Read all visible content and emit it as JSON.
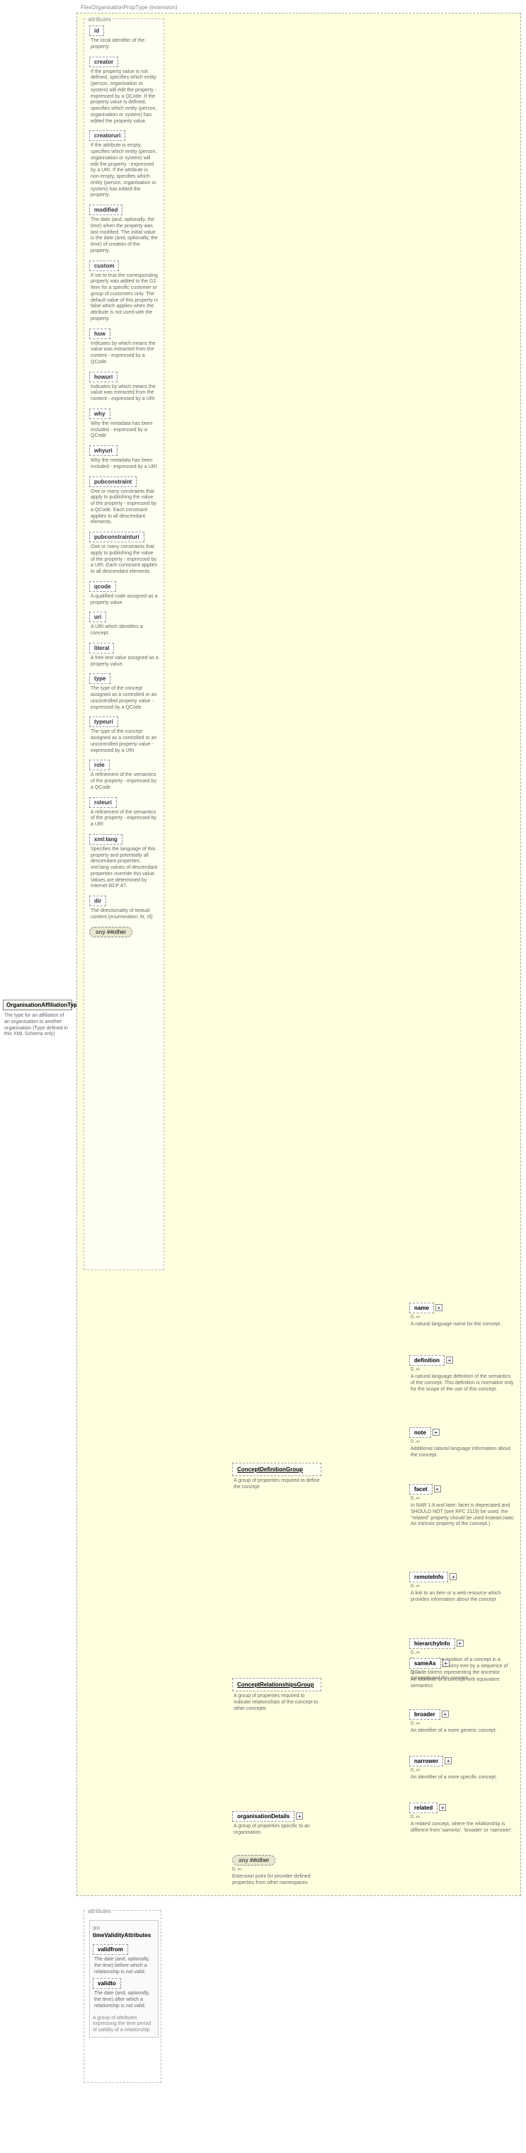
{
  "extension_header": "FlexOrganisationPropType (extension)",
  "root": {
    "title": "OrganisationAffiliationType",
    "desc": "The type for an affiliation of an organisation to another organisation (Type defined in this XML Schema only)"
  },
  "attr_frame1": {
    "label": "attributes"
  },
  "attributes1": [
    {
      "name": "id",
      "note": "The local identifier of the property."
    },
    {
      "name": "creator",
      "note": "If the property value is not defined, specifies which entity (person, organisation or system) will edit the property - expressed by a QCode. If the property value is defined, specifies which entity (person, organisation or system) has edited the property value."
    },
    {
      "name": "creatoruri",
      "note": "If the attribute is empty, specifies which entity (person, organisation or system) will edit the property - expressed by a URI. If the attribute is non-empty, specifies which entity (person, organisation or system) has edited the property."
    },
    {
      "name": "modified",
      "note": "The date (and, optionally, the time) when the property was last modified. The initial value is the date (and, optionally, the time) of creation of the property."
    },
    {
      "name": "custom",
      "note": "If set to true the corresponding property was added to the G2 Item for a specific customer or group of customers only. The default value of this property is false which applies when the attribute is not used with the property."
    },
    {
      "name": "how",
      "note": "Indicates by which means the value was extracted from the content - expressed by a QCode"
    },
    {
      "name": "howuri",
      "note": "Indicates by which means the value was extracted from the content - expressed by a URI"
    },
    {
      "name": "why",
      "note": "Why the metadata has been included - expressed by a QCode"
    },
    {
      "name": "whyuri",
      "note": "Why the metadata has been included - expressed by a URI"
    },
    {
      "name": "pubconstraint",
      "note": "One or many constraints that apply to publishing the value of the property - expressed by a QCode. Each constraint applies to all descendant elements."
    },
    {
      "name": "pubconstrainturi",
      "note": "One or many constraints that apply to publishing the value of the property - expressed by a URI. Each constraint applies to all descendant elements."
    },
    {
      "name": "qcode",
      "note": "A qualified code assigned as a property value."
    },
    {
      "name": "uri",
      "note": "A URI which identifies a concept."
    },
    {
      "name": "literal",
      "note": "A free-text value assigned as a property value."
    },
    {
      "name": "type",
      "note": "The type of the concept assigned as a controlled or an uncontrolled property value - expressed by a QCode"
    },
    {
      "name": "typeuri",
      "note": "The type of the concept assigned as a controlled or an uncontrolled property value - expressed by a URI"
    },
    {
      "name": "role",
      "note": "A refinement of the semantics of the property - expressed by a QCode"
    },
    {
      "name": "roleuri",
      "note": "A refinement of the semantics of the property - expressed by a URI"
    },
    {
      "name": "xml:lang",
      "note": "Specifies the language of this property and potentially all descendant properties. xml:lang values of descendant properties override this value. Values are determined by Internet BCP 47."
    },
    {
      "name": "dir",
      "note": "The directionality of textual content (enumeration: ltr, rtl)"
    }
  ],
  "other_pill1": {
    "prefix": "any",
    "suffix": "##other"
  },
  "groups": {
    "cdg": {
      "label": "ConceptDefinitionGroup",
      "note": "A group of properites required to define the concept"
    },
    "crg": {
      "label": "ConceptRelationshipsGroup",
      "note": "A group of properites required to indicate relationships of the concept to other concepts"
    }
  },
  "cdg_children": [
    {
      "name": "name",
      "card": "0..∞",
      "note": "A natural language name for the concept."
    },
    {
      "name": "definition",
      "card": "0..∞",
      "note": "A natural language definition of the semantics of the concept. This definition is normative only for the scope of the use of this concept."
    },
    {
      "name": "note",
      "card": "0..∞",
      "note": "Additional natural language information about the concept."
    },
    {
      "name": "facet",
      "card": "0..∞",
      "note": "In NAR 1.8 and later: facet is deprecated and SHOULD NOT (see RFC 2119) be used, the \"related\" property should be used instead.(was: An intrinsic property of the concept.)"
    },
    {
      "name": "remoteInfo",
      "card": "0..∞",
      "note": "A link to an item or a web resource which provides information about the concept"
    },
    {
      "name": "hierarchyInfo",
      "card": "0..∞",
      "note": "Represents the position of a concept in a hierarchical taxonomy tree by a sequence of QCode tokens representing the ancestor concepts and this concept"
    }
  ],
  "crg_children": [
    {
      "name": "sameAs",
      "card": "0..∞",
      "note": "An identifier of a concept with equivalent semantics"
    },
    {
      "name": "broader",
      "card": "0..∞",
      "note": "An identifier of a more generic concept."
    },
    {
      "name": "narrower",
      "card": "0..∞",
      "note": "An identifier of a more specific concept."
    },
    {
      "name": "related",
      "card": "0..∞",
      "note": "A related concept, where the relationship is different from 'sameAs', 'broader' or 'narrower'."
    }
  ],
  "org_details": {
    "name": "organisationDetails",
    "note": "A group of properties specific to an organisation"
  },
  "other_pill2": {
    "prefix": "any",
    "suffix": "##other",
    "card": "0..∞",
    "note": "Extension point for provider-defined properties from other namespaces"
  },
  "attr_frame2": {
    "label": "attributes"
  },
  "validity": {
    "group_label_prefix": "grp",
    "group_label": "timeValidityAttributes",
    "attrs": [
      {
        "name": "validfrom",
        "note": "The date (and, optionally, the time) before which a relationship is not valid."
      },
      {
        "name": "validto",
        "note": "The date (and, optionally, the time) after which a relationship is not valid."
      }
    ],
    "footnote": "A group of attributes expressing the time period of validity of a relationship"
  }
}
